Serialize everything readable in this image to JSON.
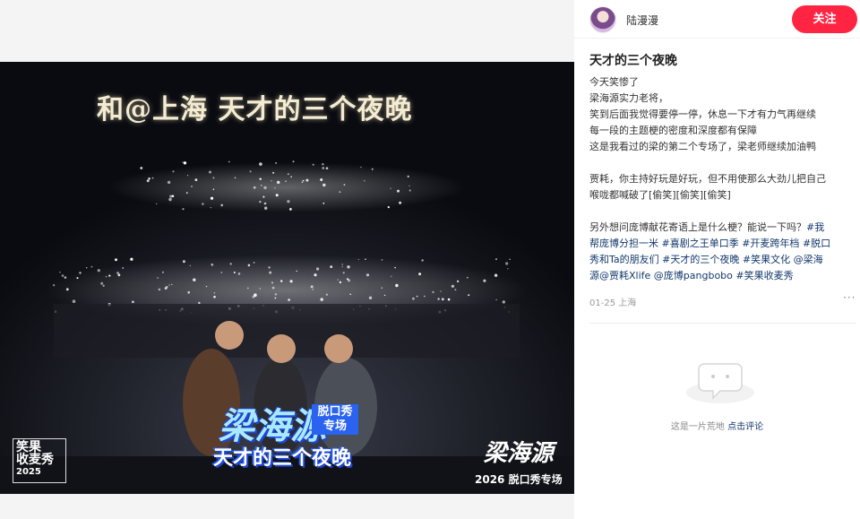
{
  "photo": {
    "headline": "和@上海 天才的三个夜晚",
    "show_name": "梁海源",
    "show_sub": "脱口秀专场",
    "show_tagline": "天才的三个夜晚",
    "corner_logo_line1": "笑果",
    "corner_logo_line2": "收麦秀",
    "corner_logo_year": "2025",
    "brand_signature": "梁海源",
    "brand_sub": "2026 脱口秀专场"
  },
  "author": {
    "name": "陆漫漫",
    "follow_label": "关注"
  },
  "note": {
    "title": "天才的三个夜晚",
    "lines": [
      "今天笑惨了",
      "梁海源实力老将，",
      "笑到后面我觉得要停一停，休息一下才有力气再继续",
      "每一段的主题梗的密度和深度都有保障",
      "这是我看过的梁的第二个专场了，梁老师继续加油鸭"
    ],
    "para2_line1": "贾耗，你主持好玩是好玩，但不用使那么大劲儿把自己",
    "para2_line2": "喉咙都喊破了[偷笑][偷笑][偷笑]",
    "para3_text": "另外想问庞博献花寄语上是什么梗？能说一下吗？",
    "tags": {
      "t1": "#我",
      "t2": "帮庞博分担一米",
      "t3": "#喜剧之王单口季",
      "t4": "#开麦跨年档",
      "t5": "#脱口",
      "t6": "秀和Ta的朋友们",
      "t7": "#天才的三个夜晚",
      "t8": "#笑果文化",
      "t9": "@梁海",
      "t10": "源@贾耗Xlife",
      "t11": "@庞博pangbobo",
      "t12": "#笑果收麦秀"
    },
    "meta": "01-25 上海",
    "more": "···"
  },
  "comments": {
    "empty_text": "这是一片荒地",
    "empty_link": "点击评论"
  },
  "colors": {
    "accent": "#ff2442",
    "tag": "#13386c"
  }
}
